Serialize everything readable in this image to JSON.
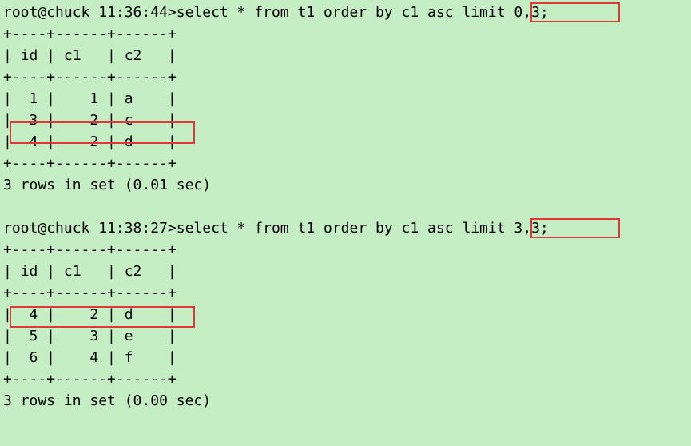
{
  "query1": {
    "prompt": "root@chuck 11:36:44>",
    "sql_before_limit": "select * from t1 order by c1 asc ",
    "sql_limit": "limit 0,3;",
    "border_top": "+----+------+------+",
    "header": "| id | c1   | c2   |",
    "border_mid": "+----+------+------+",
    "rows": [
      "|  1 |    1 | a    |",
      "|  3 |    2 | c    |",
      "|  4 |    2 | d    |"
    ],
    "border_bottom": "+----+------+------+",
    "status": "3 rows in set (0.01 sec)"
  },
  "query2": {
    "prompt": "root@chuck 11:38:27>",
    "sql_before_limit": "select * from t1 order by c1 asc ",
    "sql_limit": "limit 3,3;",
    "border_top": "+----+------+------+",
    "header": "| id | c1   | c2   |",
    "border_mid": "+----+------+------+",
    "rows": [
      "|  4 |    2 | d    |",
      "|  5 |    3 | e    |",
      "|  6 |    4 | f    |"
    ],
    "border_bottom": "+----+------+------+",
    "status": "3 rows in set (0.00 sec)"
  },
  "highlight_color": "#e03838"
}
